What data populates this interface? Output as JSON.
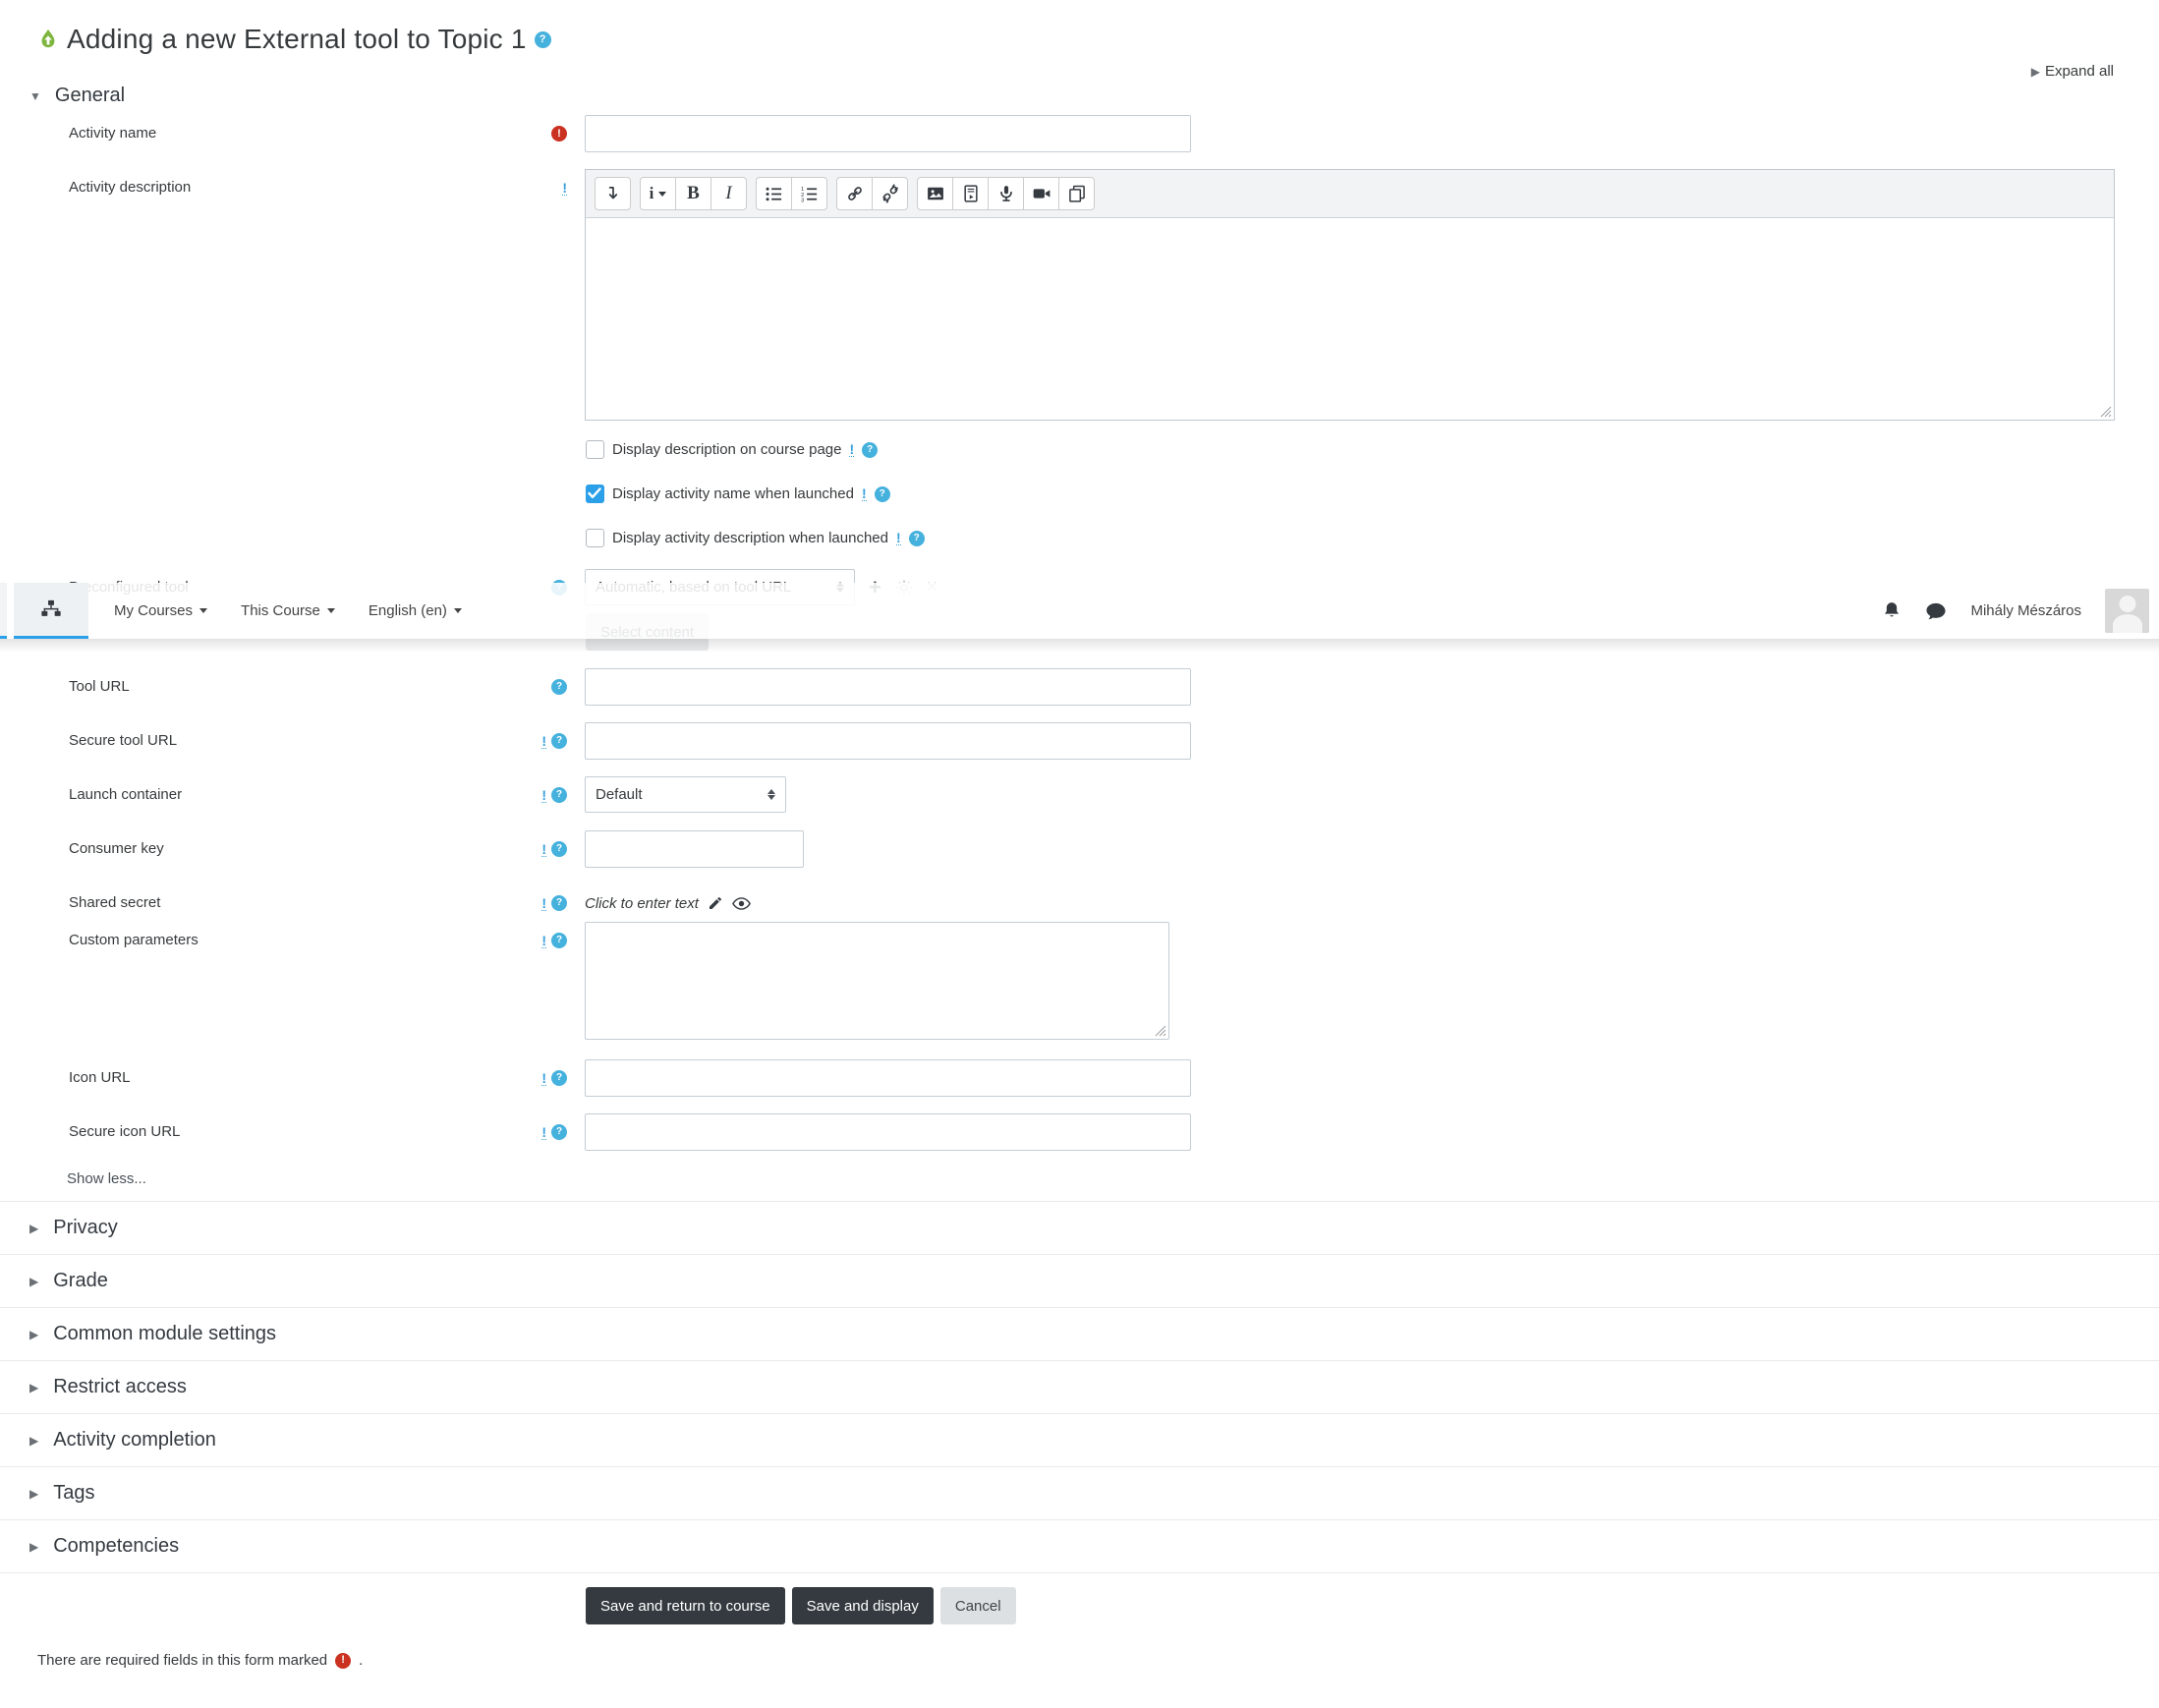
{
  "header": {
    "title": "Adding a new External tool to Topic 1",
    "expand_all": "Expand all",
    "title_icon": "external-tool-icon",
    "help_icon": "help-question-icon"
  },
  "navbar": {
    "app_icon": "sitemap-icon",
    "menus": [
      "My Courses",
      "This Course",
      "English (en)"
    ],
    "icons": [
      "bell-icon",
      "chat-icon"
    ],
    "user_name": "Mihály Mészáros"
  },
  "form": {
    "general": {
      "heading": "General",
      "activity_name": {
        "label": "Activity name"
      },
      "activity_description": {
        "label": "Activity description"
      },
      "checkboxes": [
        {
          "label": "Display description on course page",
          "checked": false
        },
        {
          "label": "Display activity name when launched",
          "checked": true
        },
        {
          "label": "Display activity description when launched",
          "checked": false
        }
      ]
    },
    "editor": {
      "toolbar_icons": [
        "collapse-toolbar",
        "styles-menu",
        "bold",
        "italic",
        "unordered-list",
        "ordered-list",
        "link",
        "unlink",
        "insert-image",
        "insert-media",
        "record-audio",
        "record-video",
        "manage-files"
      ]
    },
    "preconfigured": {
      "label": "Preconfigured tool",
      "value": "Automatic, based on tool URL"
    },
    "select_content": "Select content",
    "rows": {
      "tool_url": {
        "label": "Tool URL"
      },
      "secure_tool_url": {
        "label": "Secure tool URL"
      },
      "launch_container": {
        "label": "Launch container",
        "value": "Default"
      },
      "consumer_key": {
        "label": "Consumer key"
      },
      "shared_secret": {
        "label": "Shared secret",
        "placeholder": "Click to enter text"
      },
      "custom_parameters": {
        "label": "Custom parameters"
      },
      "icon_url": {
        "label": "Icon URL"
      },
      "secure_icon_url": {
        "label": "Secure icon URL"
      }
    },
    "show_less": "Show less...",
    "collapsed": [
      "Privacy",
      "Grade",
      "Common module settings",
      "Restrict access",
      "Activity completion",
      "Tags",
      "Competencies"
    ],
    "actions": {
      "save_return": "Save and return to course",
      "save_display": "Save and display",
      "cancel": "Cancel"
    },
    "footer": {
      "note": "There are required fields in this form marked",
      "suffix": "."
    }
  },
  "colors": {
    "accent_blue": "#2b9fe8",
    "help_blue": "#45b1dd",
    "required_red": "#ca3120",
    "tool_green": "#7db63e",
    "button_dark": "#343a40"
  }
}
